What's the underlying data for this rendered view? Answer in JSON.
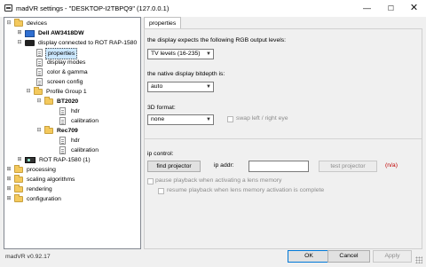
{
  "window": {
    "title": "madVR settings - \"DESKTOP-I2TBPQ9\" (127.0.0.1)",
    "minimize": "—",
    "maximize": "☐",
    "close": "✕"
  },
  "tree": {
    "root_devices": "devices",
    "monitor": "Dell AW3418DW",
    "display": "display connected to ROT RAP-1580",
    "properties": "properties",
    "display_modes": "display modes",
    "color_gamma": "color & gamma",
    "screen_config": "screen config",
    "profile_group": "Profile Group 1",
    "bt2020": "BT2020",
    "bt2020_hdr": "hdr",
    "bt2020_calibration": "calibration",
    "rec709": "Rec709",
    "rec709_hdr": "hdr",
    "rec709_calibration": "calibration",
    "rot_device": "ROT RAP-1580 (1)",
    "processing": "processing",
    "scaling": "scaling algorithms",
    "rendering": "rendering",
    "configuration": "configuration"
  },
  "tab": {
    "label": "properties"
  },
  "properties": {
    "rgb_label": "the display expects the following RGB output levels:",
    "rgb_value": "TV levels (16-235)",
    "bitdepth_label": "the native display bitdepth is:",
    "bitdepth_value": "auto",
    "format3d_label": "3D format:",
    "format3d_value": "none",
    "swap_label": "swap left / right eye",
    "ip_control_label": "ip control:",
    "find_projector": "find projector",
    "ip_addr_label": "ip addr:",
    "ip_addr_value": "",
    "test_projector": "test projector",
    "na_label": "(n/a)",
    "pause_label": "pause playback when activating a lens memory",
    "resume_label": "resume playback when lens memory activation is complete"
  },
  "footer": {
    "version": "madVR v0.92.17",
    "ok": "OK",
    "cancel": "Cancel",
    "apply": "Apply"
  },
  "icons": {
    "expanded": "⊟",
    "collapsed": "⊞",
    "dropdown": "▼"
  },
  "colors": {
    "selection": "#cce8ff",
    "folder": "#f4c95d",
    "na_red": "#c00000",
    "default_button_border": "#0078d7"
  }
}
